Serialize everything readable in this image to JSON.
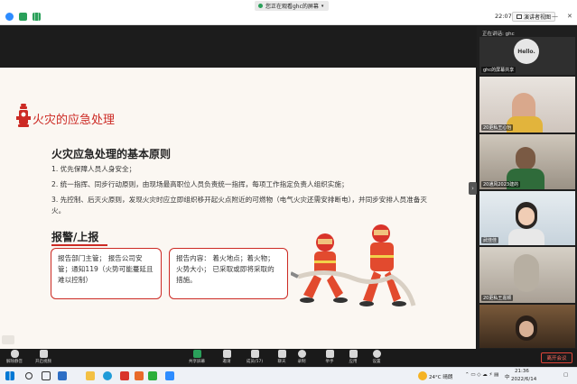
{
  "topbar": {
    "sharing_text": "您正在观看ghc的屏幕",
    "time": "22:07",
    "view_label": "演讲者视图",
    "colors": {
      "green": "#2aa05a",
      "blue": "#2d8cff",
      "orange": "#f5a623"
    }
  },
  "slide": {
    "title": "火灾的应急处理",
    "heading": "火灾应急处理的基本原则",
    "items": [
      "1. 优先保障人员人身安全；",
      "2. 统一指挥、同步行动原则，由现场最高职位人员负责统一指挥，每项工作指定负责人组织实施；",
      "3. 先控制、后灭火原则，发现火灾时应立即组织移开起火点附近的可燃物（电气火灾还需安排断电），并同步安排人员准备灭火。"
    ],
    "report_heading": "报警/上报",
    "box1": "报告部门主管； 报告公司安管；通知119（火势可能蔓延且难以控制）",
    "box2": "报告内容： 着火地点；着火物； 火势大小； 已采取或即将采取的措施。",
    "accent_color": "#cc2a24"
  },
  "sidebar": {
    "speaker_label": "正在讲话: ghc",
    "hello_text": "Hello.",
    "tiles": [
      {
        "name": "ghc的屏幕共享"
      },
      {
        "name": "20更私王心怡"
      },
      {
        "name": "20通风2023建的"
      },
      {
        "name": "武佳佳"
      },
      {
        "name": "20更私王嘉颖"
      },
      {
        "name": ""
      }
    ]
  },
  "toolbar": {
    "left": [
      {
        "label": "解除静音",
        "icon": "mic-muted-icon"
      },
      {
        "label": "开启视频",
        "icon": "video-off-icon"
      }
    ],
    "center": [
      {
        "label": "共享屏幕",
        "icon": "share-screen-icon"
      },
      {
        "label": "邀请",
        "icon": "invite-icon"
      },
      {
        "label": "成员(57)",
        "icon": "participants-icon"
      },
      {
        "label": "聊天",
        "icon": "chat-icon"
      },
      {
        "label": "录制",
        "icon": "record-icon"
      },
      {
        "label": "举手",
        "icon": "raise-hand-icon"
      },
      {
        "label": "应用",
        "icon": "apps-icon"
      },
      {
        "label": "设置",
        "icon": "settings-icon"
      }
    ],
    "leave_label": "离开会议"
  },
  "taskbar": {
    "weather": "24°C 晴朗",
    "clock_time": "21:36",
    "clock_date": "2022/6/14",
    "lang": "中"
  }
}
